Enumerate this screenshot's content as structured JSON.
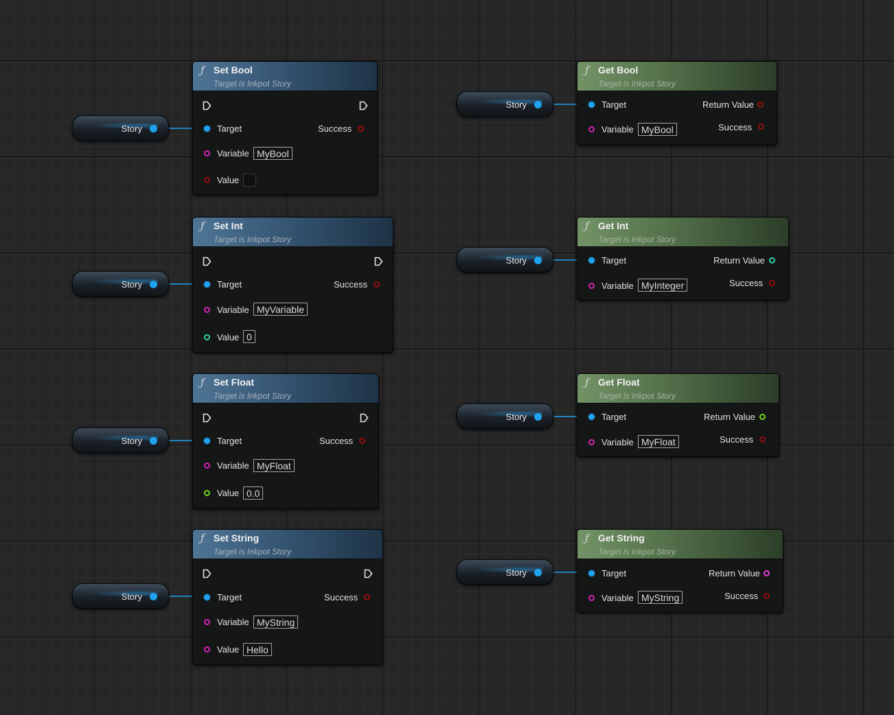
{
  "subtitle_text": "Target is Inkpot Story",
  "story_label": "Story",
  "pin_labels": {
    "target": "Target",
    "variable": "Variable",
    "value": "Value",
    "success": "Success",
    "return_value": "Return Value"
  },
  "colors": {
    "object_pin": "#1fa3f0",
    "name_pin": "#d722b8",
    "bool_pin": "#950e0e",
    "int_pin": "#2bd1a4",
    "float_pin": "#6fd91e",
    "string_pin": "#e43ad0",
    "set_header": "#365673",
    "get_header": "#526f49"
  },
  "set_nodes": [
    {
      "title": "Set Bool",
      "variable": "MyBool",
      "value": ""
    },
    {
      "title": "Set Int",
      "variable": "MyVariable",
      "value": "0"
    },
    {
      "title": "Set Float",
      "variable": "MyFloat",
      "value": "0.0"
    },
    {
      "title": "Set String",
      "variable": "MyString",
      "value": "Hello"
    }
  ],
  "get_nodes": [
    {
      "title": "Get Bool",
      "variable": "MyBool"
    },
    {
      "title": "Get Int",
      "variable": "MyInteger"
    },
    {
      "title": "Get Float",
      "variable": "MyFloat"
    },
    {
      "title": "Get String",
      "variable": "MyString"
    }
  ]
}
